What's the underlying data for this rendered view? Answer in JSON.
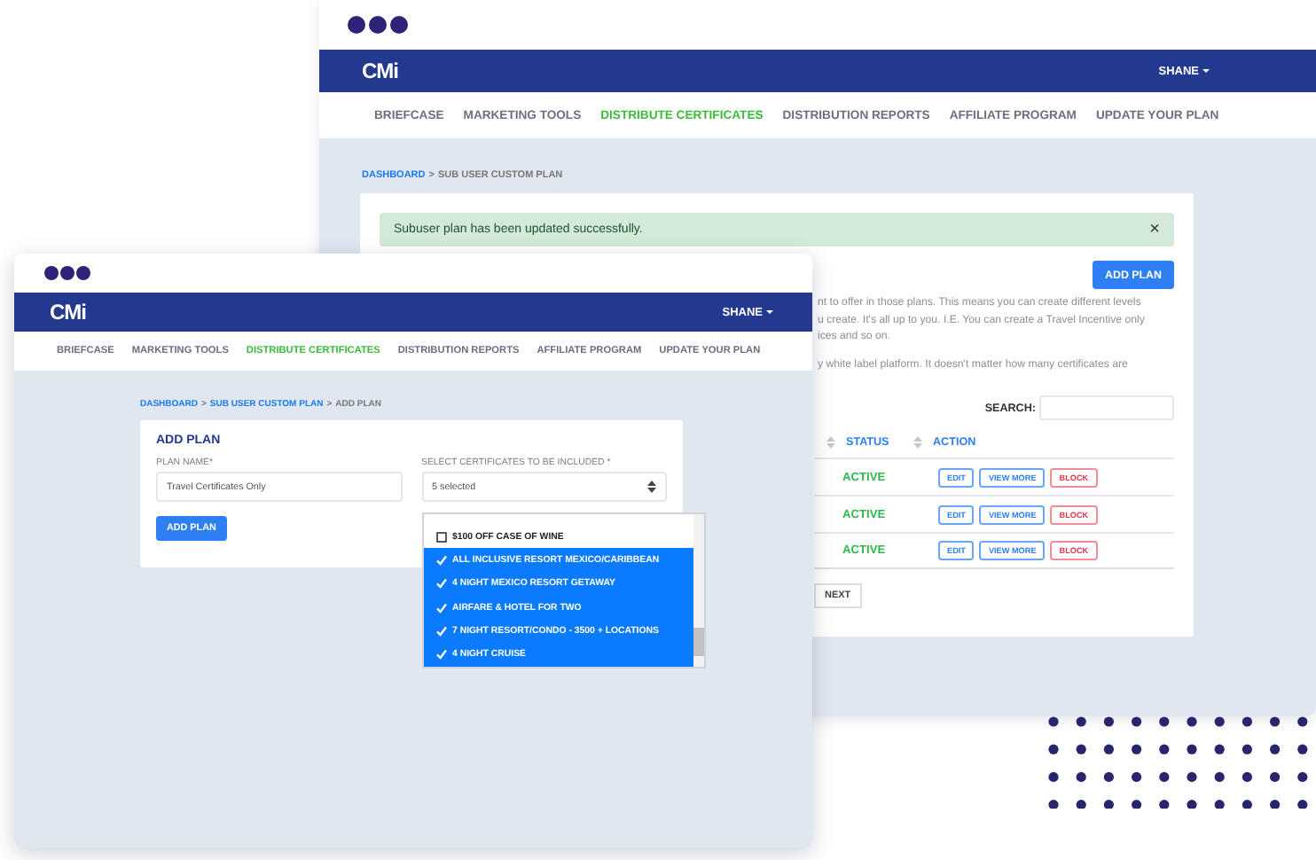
{
  "back_window": {
    "logo": "CMi",
    "user_menu": "SHANE",
    "nav": [
      {
        "label": "BRIEFCASE",
        "selected": false
      },
      {
        "label": "MARKETING TOOLS",
        "selected": false
      },
      {
        "label": "DISTRIBUTE CERTIFICATES",
        "selected": true
      },
      {
        "label": "DISTRIBUTION REPORTS",
        "selected": false
      },
      {
        "label": "AFFILIATE PROGRAM",
        "selected": false
      },
      {
        "label": "UPDATE YOUR PLAN",
        "selected": false
      }
    ],
    "breadcrumb_separator": ">",
    "breadcrumb": [
      {
        "label": "DASHBOARD",
        "link": true
      },
      {
        "label": "SUB USER CUSTOM PLAN",
        "link": false
      }
    ],
    "alert": {
      "message": "Subuser plan has been updated successfully.",
      "close": "×"
    },
    "add_plan_button": "ADD PLAN",
    "description": [
      [
        "nt to offer in those plans. This means you can create different levels",
        "u create. It's all up to you. I.E. You can create a Travel Incentive only",
        "ices and so on."
      ],
      [
        "y white label platform. It doesn't matter how many certificates are"
      ]
    ],
    "search": {
      "label": "SEARCH:"
    },
    "table": {
      "columns": [
        {
          "label": "STATUS"
        },
        {
          "label": "ACTION"
        }
      ],
      "rows": [
        {
          "status": "ACTIVE",
          "actions": [
            {
              "label": "EDIT",
              "kind": "primary"
            },
            {
              "label": "VIEW MORE",
              "kind": "primary"
            },
            {
              "label": "BLOCK",
              "kind": "danger"
            }
          ]
        },
        {
          "status": "ACTIVE",
          "actions": [
            {
              "label": "EDIT",
              "kind": "primary"
            },
            {
              "label": "VIEW MORE",
              "kind": "primary"
            },
            {
              "label": "BLOCK",
              "kind": "danger"
            }
          ]
        },
        {
          "status": "ACTIVE",
          "actions": [
            {
              "label": "EDIT",
              "kind": "primary"
            },
            {
              "label": "VIEW MORE",
              "kind": "primary"
            },
            {
              "label": "BLOCK",
              "kind": "danger"
            }
          ]
        }
      ]
    },
    "next_button": "NEXT"
  },
  "front_window": {
    "logo": "CMi",
    "user_menu": "SHANE",
    "nav": [
      {
        "label": "BRIEFCASE",
        "selected": false
      },
      {
        "label": "MARKETING TOOLS",
        "selected": false
      },
      {
        "label": "DISTRIBUTE CERTIFICATES",
        "selected": true
      },
      {
        "label": "DISTRIBUTION REPORTS",
        "selected": false
      },
      {
        "label": "AFFILIATE PROGRAM",
        "selected": false
      },
      {
        "label": "UPDATE YOUR PLAN",
        "selected": false
      }
    ],
    "breadcrumb_separator": ">",
    "breadcrumb": [
      {
        "label": "DASHBOARD",
        "link": true
      },
      {
        "label": "SUB USER CUSTOM PLAN",
        "link": true
      },
      {
        "label": "ADD PLAN",
        "link": false
      }
    ],
    "form": {
      "title": "ADD PLAN",
      "plan_name": {
        "label": "PLAN NAME*",
        "value": "Travel Certificates Only"
      },
      "certificates": {
        "label": "SELECT CERTIFICATES TO BE INCLUDED *",
        "value": "5 selected",
        "options": [
          {
            "label": "$100 OFF CASE OF WINE",
            "selected": false
          },
          {
            "label": "ALL INCLUSIVE RESORT MEXICO/CARIBBEAN",
            "selected": true
          },
          {
            "label": "4 NIGHT MEXICO RESORT GETAWAY",
            "selected": true
          },
          {
            "label": "AIRFARE & HOTEL FOR TWO",
            "selected": true
          },
          {
            "label": "7 NIGHT RESORT/CONDO - 3500 + LOCATIONS",
            "selected": true
          },
          {
            "label": "4 NIGHT CRUISE",
            "selected": true
          }
        ]
      },
      "submit": "ADD PLAN"
    }
  }
}
